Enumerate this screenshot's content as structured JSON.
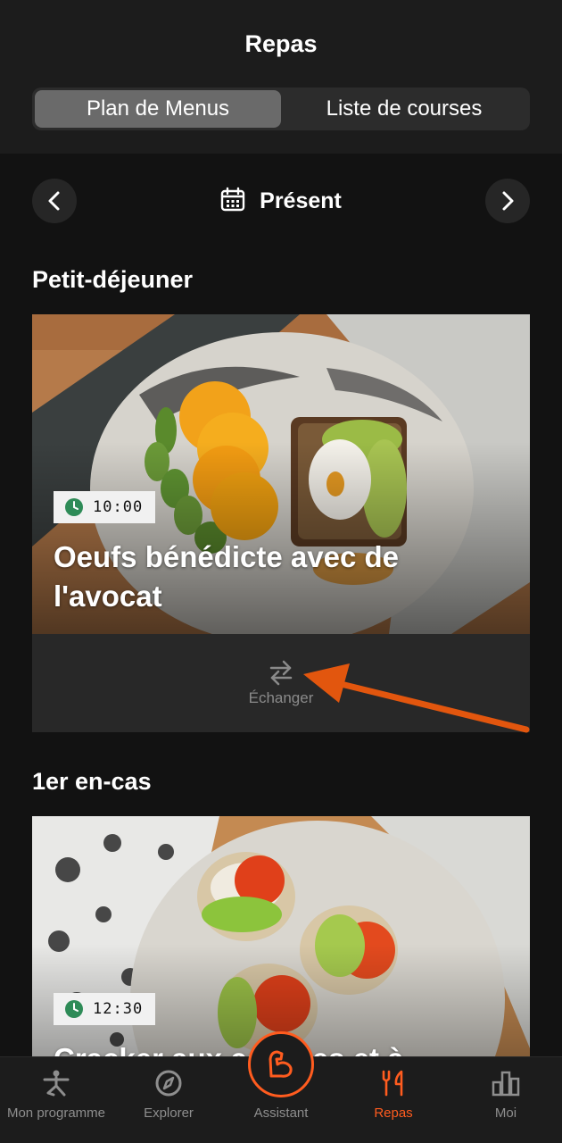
{
  "header": {
    "title": "Repas",
    "tabs": [
      {
        "label": "Plan de Menus",
        "active": true
      },
      {
        "label": "Liste de courses",
        "active": false
      }
    ]
  },
  "date_nav": {
    "label": "Présent",
    "prev_icon": "chevron-left-icon",
    "next_icon": "chevron-right-icon",
    "calendar_icon": "calendar-icon"
  },
  "meals": [
    {
      "section": "Petit-déjeuner",
      "time": "10:00",
      "title": "Oeufs bénédicte avec de l'avocat",
      "swap_label": "Échanger"
    },
    {
      "section": "1er en-cas",
      "time": "12:30",
      "title": "Cracker aux carottes et à"
    }
  ],
  "tabbar": {
    "items": [
      {
        "label": "Mon programme",
        "icon": "yoga-pose-icon"
      },
      {
        "label": "Explorer",
        "icon": "compass-icon"
      },
      {
        "label": "Assistant",
        "icon": "muscle-arm-icon"
      },
      {
        "label": "Repas",
        "icon": "fork-knife-icon",
        "active": true
      },
      {
        "label": "Moi",
        "icon": "bar-chart-icon"
      }
    ]
  },
  "colors": {
    "accent": "#ff5c1f",
    "background": "#121212",
    "header": "#1c1c1c"
  }
}
